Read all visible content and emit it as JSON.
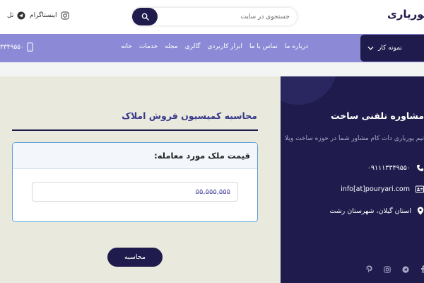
{
  "header": {
    "logo": "پوریاری",
    "search": {
      "placeholder": "جستجوی در سایت"
    },
    "instagram_label": "اینستاگرام",
    "telegram_label": "تل"
  },
  "nav": {
    "phone": "۳۳۴۹۵۵۰",
    "items": [
      "خانه",
      "خدمات",
      "مجله",
      "گالری",
      "ابزار کاربردی",
      "تماس با ما",
      "درباره ما"
    ],
    "dropdown_label": "نمونه کار"
  },
  "calculator": {
    "title": "محاسبه کمیسیون فروش املاک",
    "field_label": "قیمت ملک مورد معامله:",
    "price_value": "۵۵,۵۵۵,۵۵۵",
    "submit_label": "محاسبه"
  },
  "panel": {
    "title": "مشاوره تلفنی ساخت",
    "description": "تیم پوریاری دات کام مشاور شما در حوزه ساخت ویلا",
    "phone": "۰۹۱۱۱۳۳۴۹۵۵۰",
    "email": "info[at]pouryari.com",
    "address": "استان گیلان، شهرستان رشت"
  },
  "colors": {
    "navy": "#1f1c4d",
    "nav_purple": "#8c8ad6",
    "calc_bg": "#e9eadd",
    "card_border": "#5a9fd8",
    "title_blue": "#3a3a8c"
  },
  "icons": [
    "search-icon",
    "instagram-icon",
    "telegram-icon",
    "mobile-phone-icon",
    "chevron-down-icon",
    "phone-icon",
    "id-card-icon",
    "map-pin-icon",
    "pinterest-icon",
    "facebook-icon"
  ]
}
